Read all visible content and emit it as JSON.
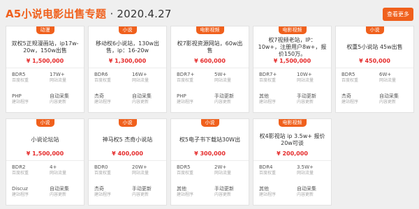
{
  "header": {
    "title": "A5小说电影出售专题",
    "date": "· 2020.4.27",
    "more_label": "查看更多"
  },
  "cards": [
    {
      "badge": "动漫",
      "title": "双权5正规漫画站，ip17w-20w，150w出售",
      "price": "¥ 1,500,000",
      "r1": {
        "a_val": "BDR5",
        "a_lab": "百度权重",
        "b_val": "17W+",
        "b_lab": "网站流量"
      },
      "r2": {
        "a_val": "PHP",
        "a_lab": "建站程序",
        "b_val": "自动采集",
        "b_lab": "内容更新"
      }
    },
    {
      "badge": "小说",
      "title": "移动权6小说站，130w出售，ip：16-20w",
      "price": "¥ 1,300,000",
      "r1": {
        "a_val": "BDR6",
        "a_lab": "百度权重",
        "b_val": "16W+",
        "b_lab": "网站流量"
      },
      "r2": {
        "a_val": "杰奇",
        "a_lab": "建站程序",
        "b_val": "自动采集",
        "b_lab": "内容更新"
      }
    },
    {
      "badge": "电影视频",
      "title": "权7影视资源网站，60w出售",
      "price": "¥ 600,000",
      "r1": {
        "a_val": "BDR7+",
        "a_lab": "百度权重",
        "b_val": "5W+",
        "b_lab": "网站流量"
      },
      "r2": {
        "a_val": "PHP",
        "a_lab": "建站程序",
        "b_val": "手动更新",
        "b_lab": "内容更新"
      }
    },
    {
      "badge": "电影视频",
      "title": "权7视频老站，IP：10w+，注册用户8w+，报价150万。",
      "price": "¥ 1,500,000",
      "r1": {
        "a_val": "BDR7+",
        "a_lab": "百度权重",
        "b_val": "10W+",
        "b_lab": "网站流量"
      },
      "r2": {
        "a_val": "其他",
        "a_lab": "建站程序",
        "b_val": "手动更新",
        "b_lab": "内容更新"
      }
    },
    {
      "badge": "小说",
      "title": "权重5小说站 45w出售",
      "price": "¥ 450,000",
      "r1": {
        "a_val": "BDR5",
        "a_lab": "百度权重",
        "b_val": "6W+",
        "b_lab": "网站流量"
      },
      "r2": {
        "a_val": "杰奇",
        "a_lab": "建站程序",
        "b_val": "自动采集",
        "b_lab": "内容更新"
      }
    },
    {
      "badge": "小说",
      "title": "小说论坛站",
      "price": "¥ 1,500,000",
      "r1": {
        "a_val": "BDR2",
        "a_lab": "百度权重",
        "b_val": "4+",
        "b_lab": "网站流量"
      },
      "r2": {
        "a_val": "Discuz",
        "a_lab": "建站程序",
        "b_val": "自动采集",
        "b_lab": "内容更新"
      }
    },
    {
      "badge": "小说",
      "title": "神马权5 杰奇小说站",
      "price": "¥ 400,000",
      "r1": {
        "a_val": "BDR0",
        "a_lab": "百度权重",
        "b_val": "20W+",
        "b_lab": "网站流量"
      },
      "r2": {
        "a_val": "杰奇",
        "a_lab": "建站程序",
        "b_val": "手动更新",
        "b_lab": "内容更新"
      }
    },
    {
      "badge": "小说",
      "title": "权5电子书下载站30W出",
      "price": "¥ 300,000",
      "r1": {
        "a_val": "BDR5",
        "a_lab": "百度权重",
        "b_val": "2W+",
        "b_lab": "网站流量"
      },
      "r2": {
        "a_val": "其他",
        "a_lab": "建站程序",
        "b_val": "手动更新",
        "b_lab": "内容更新"
      }
    },
    {
      "badge": "电影视频",
      "title": "权4影视站 ip 3.5w+ 报价20w可谈",
      "price": "¥ 200,000",
      "r1": {
        "a_val": "BDR4",
        "a_lab": "百度权重",
        "b_val": "3.5W+",
        "b_lab": "网站流量"
      },
      "r2": {
        "a_val": "其他",
        "a_lab": "建站程序",
        "b_val": "自动采集",
        "b_lab": "内容更新"
      }
    }
  ]
}
